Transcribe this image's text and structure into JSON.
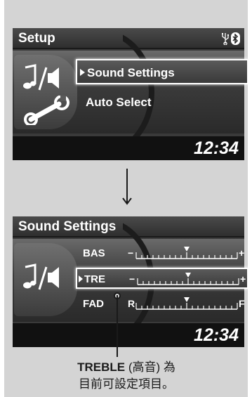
{
  "screen1": {
    "title": "Setup",
    "status_icons": [
      "usb-icon",
      "bluetooth-icon"
    ],
    "menu_items": [
      {
        "label": "Sound Settings",
        "selected": true
      },
      {
        "label": "Auto Select",
        "selected": false
      }
    ],
    "clock": "12:34"
  },
  "screen2": {
    "title": "Sound Settings",
    "rows": [
      {
        "label": "BAS",
        "left_mark": "−",
        "right_mark": "+",
        "level": 0.5,
        "selected": false
      },
      {
        "label": "TRE",
        "left_mark": "−",
        "right_mark": "+",
        "level": 0.5,
        "selected": true
      },
      {
        "label": "FAD",
        "left_mark": "R",
        "right_mark": "F",
        "level": 0.5,
        "selected": false
      }
    ],
    "clock": "12:34"
  },
  "caption": {
    "term": "TREBLE",
    "term_note": " (高音) 為",
    "line2": "目前可設定項目。"
  },
  "colors": {
    "screen_bg": "#3a3a3a",
    "highlight": "#ffffff",
    "clock_bar": "#111111",
    "page_bg": "#d4d4d4"
  }
}
